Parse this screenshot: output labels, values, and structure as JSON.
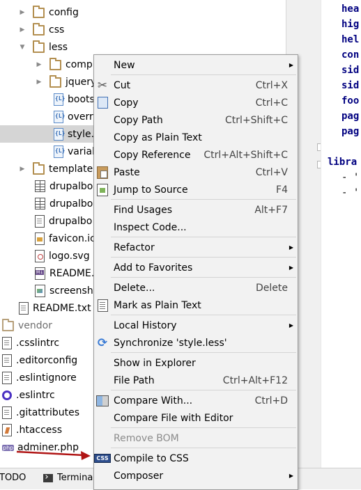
{
  "tree": {
    "items": [
      {
        "label": "config",
        "icon": "folder-icon",
        "arrow": "▶"
      },
      {
        "label": "css",
        "icon": "folder-icon",
        "arrow": "▶"
      },
      {
        "label": "less",
        "icon": "folder-icon",
        "arrow": "▼"
      },
      {
        "label": "comp",
        "icon": "folder-icon",
        "arrow": "▶"
      },
      {
        "label": "jquery",
        "icon": "folder-icon",
        "arrow": "▶"
      },
      {
        "label": "boots",
        "icon": "less-file-icon"
      },
      {
        "label": "overri",
        "icon": "less-file-icon"
      },
      {
        "label": "style.l",
        "icon": "less-file-icon"
      },
      {
        "label": "variab",
        "icon": "less-file-icon"
      },
      {
        "label": "templates",
        "icon": "folder-icon",
        "arrow": "▶"
      },
      {
        "label": "drupalbo",
        "icon": "table-file-icon"
      },
      {
        "label": "drupalbo",
        "icon": "table-file-icon"
      },
      {
        "label": "drupalbo",
        "icon": "text-file-icon"
      },
      {
        "label": "favicon.ic",
        "icon": "js-file-icon"
      },
      {
        "label": "logo.svg",
        "icon": "svg-file-icon"
      },
      {
        "label": "README.",
        "icon": "markdown-file-icon"
      },
      {
        "label": "screensho",
        "icon": "image-file-icon"
      },
      {
        "label": "README.txt",
        "icon": "text-file-icon"
      },
      {
        "label": "vendor",
        "icon": "folder-icon"
      },
      {
        "label": ".csslintrc",
        "icon": "text-file-icon"
      },
      {
        "label": ".editorconfig",
        "icon": "text-file-icon"
      },
      {
        "label": ".eslintignore",
        "icon": "text-file-icon"
      },
      {
        "label": ".eslintrc",
        "icon": "eslint-icon"
      },
      {
        "label": ".gitattributes",
        "icon": "text-file-icon"
      },
      {
        "label": ".htaccess",
        "icon": "htaccess-icon"
      },
      {
        "label": "adminer.php",
        "icon": "php-file-icon"
      }
    ]
  },
  "editor": {
    "lines": [
      "hea",
      "hig",
      "hel",
      "con",
      "sid",
      "sid",
      "foo",
      "pag",
      "pag"
    ],
    "libra": "libra",
    "items": [
      "- '",
      "- '"
    ]
  },
  "bottombar": {
    "todo": "TODO",
    "terminal": "Terminal"
  },
  "menu": {
    "items": [
      {
        "label": "New",
        "shortcut": "",
        "submenu": true
      },
      {
        "label": "Cut",
        "shortcut": "Ctrl+X"
      },
      {
        "label": "Copy",
        "shortcut": "Ctrl+C"
      },
      {
        "label": "Copy Path",
        "shortcut": "Ctrl+Shift+C"
      },
      {
        "label": "Copy as Plain Text",
        "shortcut": ""
      },
      {
        "label": "Copy Reference",
        "shortcut": "Ctrl+Alt+Shift+C"
      },
      {
        "label": "Paste",
        "shortcut": "Ctrl+V"
      },
      {
        "label": "Jump to Source",
        "shortcut": "F4"
      },
      {
        "label": "Find Usages",
        "shortcut": "Alt+F7"
      },
      {
        "label": "Inspect Code...",
        "shortcut": ""
      },
      {
        "label": "Refactor",
        "shortcut": "",
        "submenu": true
      },
      {
        "label": "Add to Favorites",
        "shortcut": "",
        "submenu": true
      },
      {
        "label": "Delete...",
        "shortcut": "Delete"
      },
      {
        "label": "Mark as Plain Text",
        "shortcut": ""
      },
      {
        "label": "Local History",
        "shortcut": "",
        "submenu": true
      },
      {
        "label": "Synchronize 'style.less'",
        "shortcut": ""
      },
      {
        "label": "Show in Explorer",
        "shortcut": ""
      },
      {
        "label": "File Path",
        "shortcut": "Ctrl+Alt+F12"
      },
      {
        "label": "Compare With...",
        "shortcut": "Ctrl+D"
      },
      {
        "label": "Compare File with Editor",
        "shortcut": ""
      },
      {
        "label": "Remove BOM",
        "shortcut": "",
        "disabled": true
      },
      {
        "label": "Compile to CSS",
        "shortcut": ""
      },
      {
        "label": "Composer",
        "shortcut": "",
        "submenu": true
      }
    ]
  },
  "colors": {
    "selection": "#d5d5d5",
    "annotation_arrow": "#b01515",
    "menu_bg": "#f2f2f2",
    "yaml_key": "#000080"
  }
}
